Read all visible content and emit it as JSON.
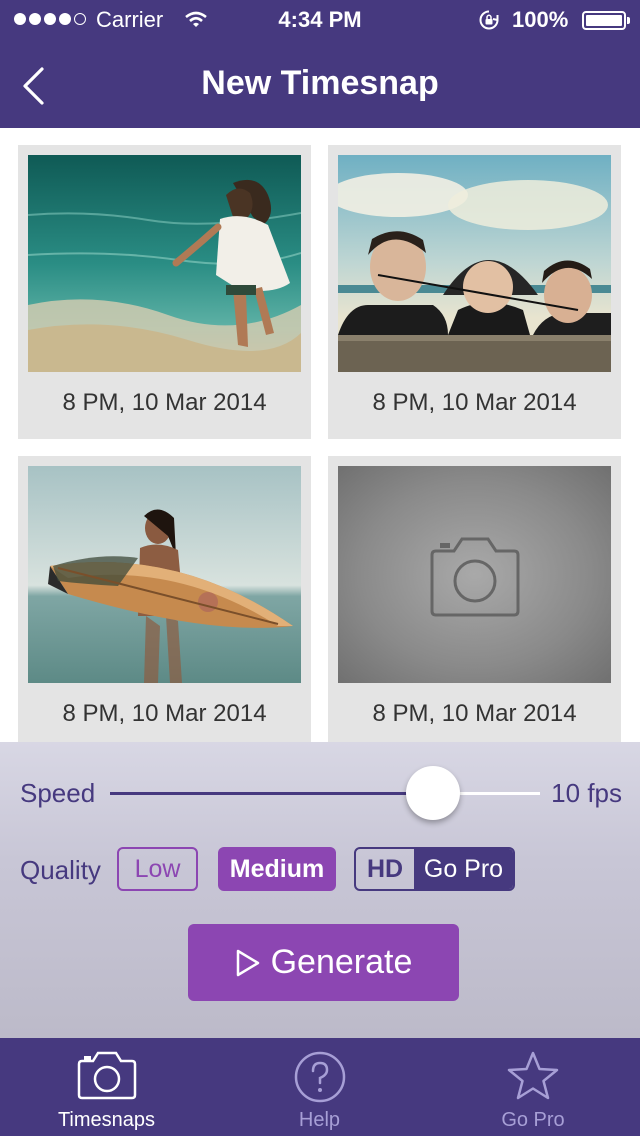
{
  "status_bar": {
    "carrier": "Carrier",
    "time": "4:34 PM",
    "battery": "100%"
  },
  "nav": {
    "title": "New Timesnap"
  },
  "snaps": [
    {
      "caption": "8 PM, 10 Mar 2014",
      "photo": "woman-running-into-sea"
    },
    {
      "caption": "8 PM, 10 Mar 2014",
      "photo": "three-men-faces-over-wall"
    },
    {
      "caption": "8 PM, 10 Mar 2014",
      "photo": "woman-with-surfboard"
    },
    {
      "caption": "8 PM, 10 Mar 2014",
      "photo": "camera-icon"
    }
  ],
  "controls": {
    "speed_label": "Speed",
    "speed_value": "10 fps",
    "speed_fraction": 0.75,
    "quality_label": "Quality",
    "quality_options": {
      "low": "Low",
      "medium": "Medium",
      "hd": "HD",
      "hd_badge": "Go Pro"
    },
    "selected_quality": "Medium",
    "generate_label": "Generate"
  },
  "tabs": [
    {
      "label": "Timesnaps",
      "icon": "camera-icon",
      "active": true
    },
    {
      "label": "Help",
      "icon": "question-icon",
      "active": false
    },
    {
      "label": "Go Pro",
      "icon": "star-icon",
      "active": false
    }
  ],
  "colors": {
    "primary": "#46397f",
    "accent": "#8c46b2",
    "tab_inactive": "#a79fd6"
  }
}
